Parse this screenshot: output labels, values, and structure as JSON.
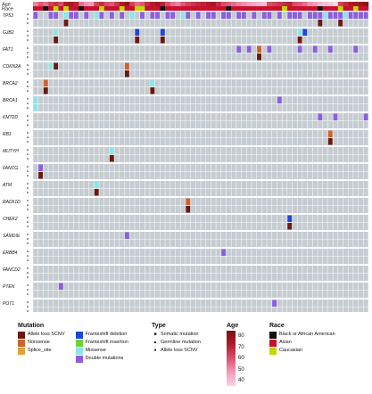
{
  "chart_data": {
    "type": "oncoprint",
    "n_samples": 66,
    "annotation_tracks": [
      "Age",
      "Race"
    ],
    "genes": [
      "TP53",
      "GJB2",
      "FAT1",
      "CDKN2A",
      "BRCA2",
      "BRCA1",
      "KMT2D",
      "RB1",
      "MUTYH",
      "FANCG",
      "ATM",
      "RAD51D",
      "CHEK2",
      "SAMD9L",
      "ERBB4",
      "FANCD2",
      "PTEN",
      "POT1"
    ],
    "race_exceptions": [
      {
        "sample": 2,
        "race": "Black or African American"
      },
      {
        "sample": 4,
        "race": "Caucasian"
      },
      {
        "sample": 6,
        "race": "Caucasian"
      },
      {
        "sample": 9,
        "race": "Black or African American"
      },
      {
        "sample": 13,
        "race": "Caucasian"
      },
      {
        "sample": 17,
        "race": "Caucasian"
      },
      {
        "sample": 20,
        "race": "Caucasian"
      },
      {
        "sample": 21,
        "race": "Caucasian"
      },
      {
        "sample": 25,
        "race": "Black or African American"
      },
      {
        "sample": 38,
        "race": "Black or African American"
      },
      {
        "sample": 49,
        "race": "Caucasian"
      },
      {
        "sample": 56,
        "race": "Black or African American"
      },
      {
        "sample": 60,
        "race": "Caucasian"
      },
      {
        "sample": 63,
        "race": "Caucasian"
      }
    ],
    "default_race": "Asian",
    "ages": [
      52,
      58,
      55,
      62,
      65,
      60,
      70,
      72,
      68,
      55,
      50,
      48,
      62,
      66,
      60,
      58,
      64,
      70,
      75,
      62,
      55,
      58,
      66,
      70,
      72,
      68,
      60,
      55,
      52,
      58,
      62,
      64,
      66,
      68,
      70,
      72,
      66,
      60,
      58,
      55,
      52,
      50,
      48,
      46,
      44,
      42,
      60,
      62,
      64,
      66,
      68,
      60,
      58,
      55,
      50,
      48,
      44,
      42,
      40,
      38,
      62,
      66,
      70,
      72,
      74,
      76
    ],
    "mutations": [
      {
        "gene": "TP53",
        "sample": 0,
        "type": "Double mutations"
      },
      {
        "gene": "TP53",
        "sample": 3,
        "type": "Double mutations"
      },
      {
        "gene": "TP53",
        "sample": 4,
        "type": "Double mutations"
      },
      {
        "gene": "TP53",
        "sample": 6,
        "type": "Missense"
      },
      {
        "gene": "TP53",
        "sample": 7,
        "type": "Double mutations"
      },
      {
        "gene": "TP53",
        "sample": 8,
        "type": "Double mutations"
      },
      {
        "gene": "TP53",
        "sample": 10,
        "type": "Double mutations"
      },
      {
        "gene": "TP53",
        "sample": 12,
        "type": "Missense"
      },
      {
        "gene": "TP53",
        "sample": 13,
        "type": "Double mutations"
      },
      {
        "gene": "TP53",
        "sample": 15,
        "type": "Double mutations"
      },
      {
        "gene": "TP53",
        "sample": 17,
        "type": "Double mutations"
      },
      {
        "gene": "TP53",
        "sample": 19,
        "type": "Missense"
      },
      {
        "gene": "TP53",
        "sample": 21,
        "type": "Double mutations"
      },
      {
        "gene": "TP53",
        "sample": 23,
        "type": "Double mutations"
      },
      {
        "gene": "TP53",
        "sample": 24,
        "type": "Double mutations"
      },
      {
        "gene": "TP53",
        "sample": 26,
        "type": "Double mutations"
      },
      {
        "gene": "TP53",
        "sample": 27,
        "type": "Double mutations"
      },
      {
        "gene": "TP53",
        "sample": 29,
        "type": "Missense"
      },
      {
        "gene": "TP53",
        "sample": 30,
        "type": "Double mutations"
      },
      {
        "gene": "TP53",
        "sample": 32,
        "type": "Double mutations"
      },
      {
        "gene": "TP53",
        "sample": 34,
        "type": "Double mutations"
      },
      {
        "gene": "TP53",
        "sample": 35,
        "type": "Double mutations"
      },
      {
        "gene": "TP53",
        "sample": 37,
        "type": "Double mutations"
      },
      {
        "gene": "TP53",
        "sample": 38,
        "type": "Double mutations"
      },
      {
        "gene": "TP53",
        "sample": 40,
        "type": "Double mutations"
      },
      {
        "gene": "TP53",
        "sample": 41,
        "type": "Double mutations"
      },
      {
        "gene": "TP53",
        "sample": 43,
        "type": "Double mutations"
      },
      {
        "gene": "TP53",
        "sample": 45,
        "type": "Double mutations"
      },
      {
        "gene": "TP53",
        "sample": 46,
        "type": "Double mutations"
      },
      {
        "gene": "TP53",
        "sample": 48,
        "type": "Double mutations"
      },
      {
        "gene": "TP53",
        "sample": 50,
        "type": "Double mutations"
      },
      {
        "gene": "TP53",
        "sample": 51,
        "type": "Double mutations"
      },
      {
        "gene": "TP53",
        "sample": 52,
        "type": "Double mutations"
      },
      {
        "gene": "TP53",
        "sample": 54,
        "type": "Double mutations"
      },
      {
        "gene": "TP53",
        "sample": 55,
        "type": "Double mutations"
      },
      {
        "gene": "TP53",
        "sample": 56,
        "type": "Double mutations"
      },
      {
        "gene": "TP53",
        "sample": 57,
        "type": "Missense"
      },
      {
        "gene": "TP53",
        "sample": 58,
        "type": "Double mutations"
      },
      {
        "gene": "TP53",
        "sample": 59,
        "type": "Double mutations"
      },
      {
        "gene": "TP53",
        "sample": 60,
        "type": "Double mutations"
      },
      {
        "gene": "TP53",
        "sample": 61,
        "type": "Missense"
      },
      {
        "gene": "TP53",
        "sample": 62,
        "type": "Double mutations"
      },
      {
        "gene": "TP53",
        "sample": 63,
        "type": "Double mutations"
      },
      {
        "gene": "TP53",
        "sample": 64,
        "type": "Double mutations"
      },
      {
        "gene": "TP53",
        "sample": 65,
        "type": "Double mutations"
      },
      {
        "gene": "TP53",
        "sample": 6,
        "type": "Allele loss SCNV",
        "secondary": true
      },
      {
        "gene": "TP53",
        "sample": 56,
        "type": "Allele loss SCNV",
        "secondary": true
      },
      {
        "gene": "TP53",
        "sample": 60,
        "type": "Allele loss SCNV",
        "secondary": true
      },
      {
        "gene": "GJB2",
        "sample": 4,
        "type": "Missense"
      },
      {
        "gene": "GJB2",
        "sample": 4,
        "type": "Allele loss SCNV",
        "secondary": true
      },
      {
        "gene": "GJB2",
        "sample": 20,
        "type": "Frameshift deletion"
      },
      {
        "gene": "GJB2",
        "sample": 20,
        "type": "Allele loss SCNV",
        "secondary": true
      },
      {
        "gene": "GJB2",
        "sample": 25,
        "type": "Frameshift deletion"
      },
      {
        "gene": "GJB2",
        "sample": 25,
        "type": "Allele loss SCNV",
        "secondary": true
      },
      {
        "gene": "GJB2",
        "sample": 52,
        "type": "Missense"
      },
      {
        "gene": "GJB2",
        "sample": 52,
        "type": "Allele loss SCNV",
        "secondary": true
      },
      {
        "gene": "GJB2",
        "sample": 53,
        "type": "Frameshift deletion"
      },
      {
        "gene": "FAT1",
        "sample": 40,
        "type": "Double mutations"
      },
      {
        "gene": "FAT1",
        "sample": 42,
        "type": "Double mutations"
      },
      {
        "gene": "FAT1",
        "sample": 44,
        "type": "Nonsense"
      },
      {
        "gene": "FAT1",
        "sample": 44,
        "type": "Allele loss SCNV",
        "secondary": true
      },
      {
        "gene": "FAT1",
        "sample": 46,
        "type": "Double mutations"
      },
      {
        "gene": "FAT1",
        "sample": 52,
        "type": "Double mutations"
      },
      {
        "gene": "FAT1",
        "sample": 55,
        "type": "Double mutations"
      },
      {
        "gene": "FAT1",
        "sample": 58,
        "type": "Double mutations"
      },
      {
        "gene": "FAT1",
        "sample": 63,
        "type": "Double mutations"
      },
      {
        "gene": "CDKN2A",
        "sample": 3,
        "type": "Missense"
      },
      {
        "gene": "CDKN2A",
        "sample": 4,
        "type": "Allele loss SCNV"
      },
      {
        "gene": "CDKN2A",
        "sample": 18,
        "type": "Nonsense"
      },
      {
        "gene": "CDKN2A",
        "sample": 18,
        "type": "Allele loss SCNV",
        "secondary": true
      },
      {
        "gene": "BRCA2",
        "sample": 2,
        "type": "Nonsense"
      },
      {
        "gene": "BRCA2",
        "sample": 2,
        "type": "Allele loss SCNV",
        "secondary": true
      },
      {
        "gene": "BRCA2",
        "sample": 23,
        "type": "Missense"
      },
      {
        "gene": "BRCA2",
        "sample": 23,
        "type": "Allele loss SCNV",
        "secondary": true
      },
      {
        "gene": "BRCA1",
        "sample": 0,
        "type": "Missense"
      },
      {
        "gene": "BRCA1",
        "sample": 0,
        "type": "Missense",
        "secondary": true
      },
      {
        "gene": "BRCA1",
        "sample": 48,
        "type": "Double mutations"
      },
      {
        "gene": "KMT2D",
        "sample": 56,
        "type": "Double mutations"
      },
      {
        "gene": "KMT2D",
        "sample": 59,
        "type": "Double mutations"
      },
      {
        "gene": "KMT2D",
        "sample": 65,
        "type": "Double mutations"
      },
      {
        "gene": "RB1",
        "sample": 58,
        "type": "Nonsense"
      },
      {
        "gene": "RB1",
        "sample": 58,
        "type": "Allele loss SCNV",
        "secondary": true
      },
      {
        "gene": "MUTYH",
        "sample": 15,
        "type": "Missense"
      },
      {
        "gene": "MUTYH",
        "sample": 15,
        "type": "Allele loss SCNV",
        "secondary": true
      },
      {
        "gene": "FANCG",
        "sample": 1,
        "type": "Double mutations"
      },
      {
        "gene": "FANCG",
        "sample": 1,
        "type": "Allele loss SCNV",
        "secondary": true
      },
      {
        "gene": "ATM",
        "sample": 12,
        "type": "Missense"
      },
      {
        "gene": "ATM",
        "sample": 12,
        "type": "Allele loss SCNV",
        "secondary": true
      },
      {
        "gene": "RAD51D",
        "sample": 30,
        "type": "Nonsense"
      },
      {
        "gene": "RAD51D",
        "sample": 30,
        "type": "Allele loss SCNV",
        "secondary": true
      },
      {
        "gene": "CHEK2",
        "sample": 50,
        "type": "Frameshift deletion"
      },
      {
        "gene": "CHEK2",
        "sample": 50,
        "type": "Allele loss SCNV",
        "secondary": true
      },
      {
        "gene": "SAMD9L",
        "sample": 18,
        "type": "Double mutations"
      },
      {
        "gene": "ERBB4",
        "sample": 37,
        "type": "Double mutations"
      },
      {
        "gene": "PTEN",
        "sample": 5,
        "type": "Double mutations"
      },
      {
        "gene": "POT1",
        "sample": 47,
        "type": "Double mutations"
      }
    ]
  },
  "legend": {
    "mutation": {
      "title": "Mutation",
      "items": [
        {
          "label": "Allele loss SCNV",
          "color": "#6b1a12"
        },
        {
          "label": "Nonsense",
          "color": "#d0632c"
        },
        {
          "label": "Splice_site",
          "color": "#e2a23a"
        },
        {
          "label": "Frameshift deletion",
          "color": "#1f46d6"
        },
        {
          "label": "Frameshift insertion",
          "color": "#6fd23a"
        },
        {
          "label": "Missense",
          "color": "#8ee5e6"
        },
        {
          "label": "Double mutations",
          "color": "#8c5fe0"
        }
      ]
    },
    "type": {
      "title": "Type",
      "items": [
        {
          "label": "Somatic mutation",
          "glyph": "■"
        },
        {
          "label": "Germline mutation",
          "glyph": "▲"
        },
        {
          "label": "Allele loss SCNV",
          "glyph": "●"
        }
      ]
    },
    "age": {
      "title": "Age",
      "ticks": [
        "80",
        "70",
        "60",
        "50",
        "40"
      ]
    },
    "race": {
      "title": "Race",
      "items": [
        {
          "label": "Black or African American",
          "color": "#111111"
        },
        {
          "label": "Asian",
          "color": "#c8102e"
        },
        {
          "label": "Caucasian",
          "color": "#c4d600"
        }
      ]
    }
  },
  "colors": {
    "cell_bg": "#c6cdd2",
    "grid_line": "#ffffff"
  }
}
